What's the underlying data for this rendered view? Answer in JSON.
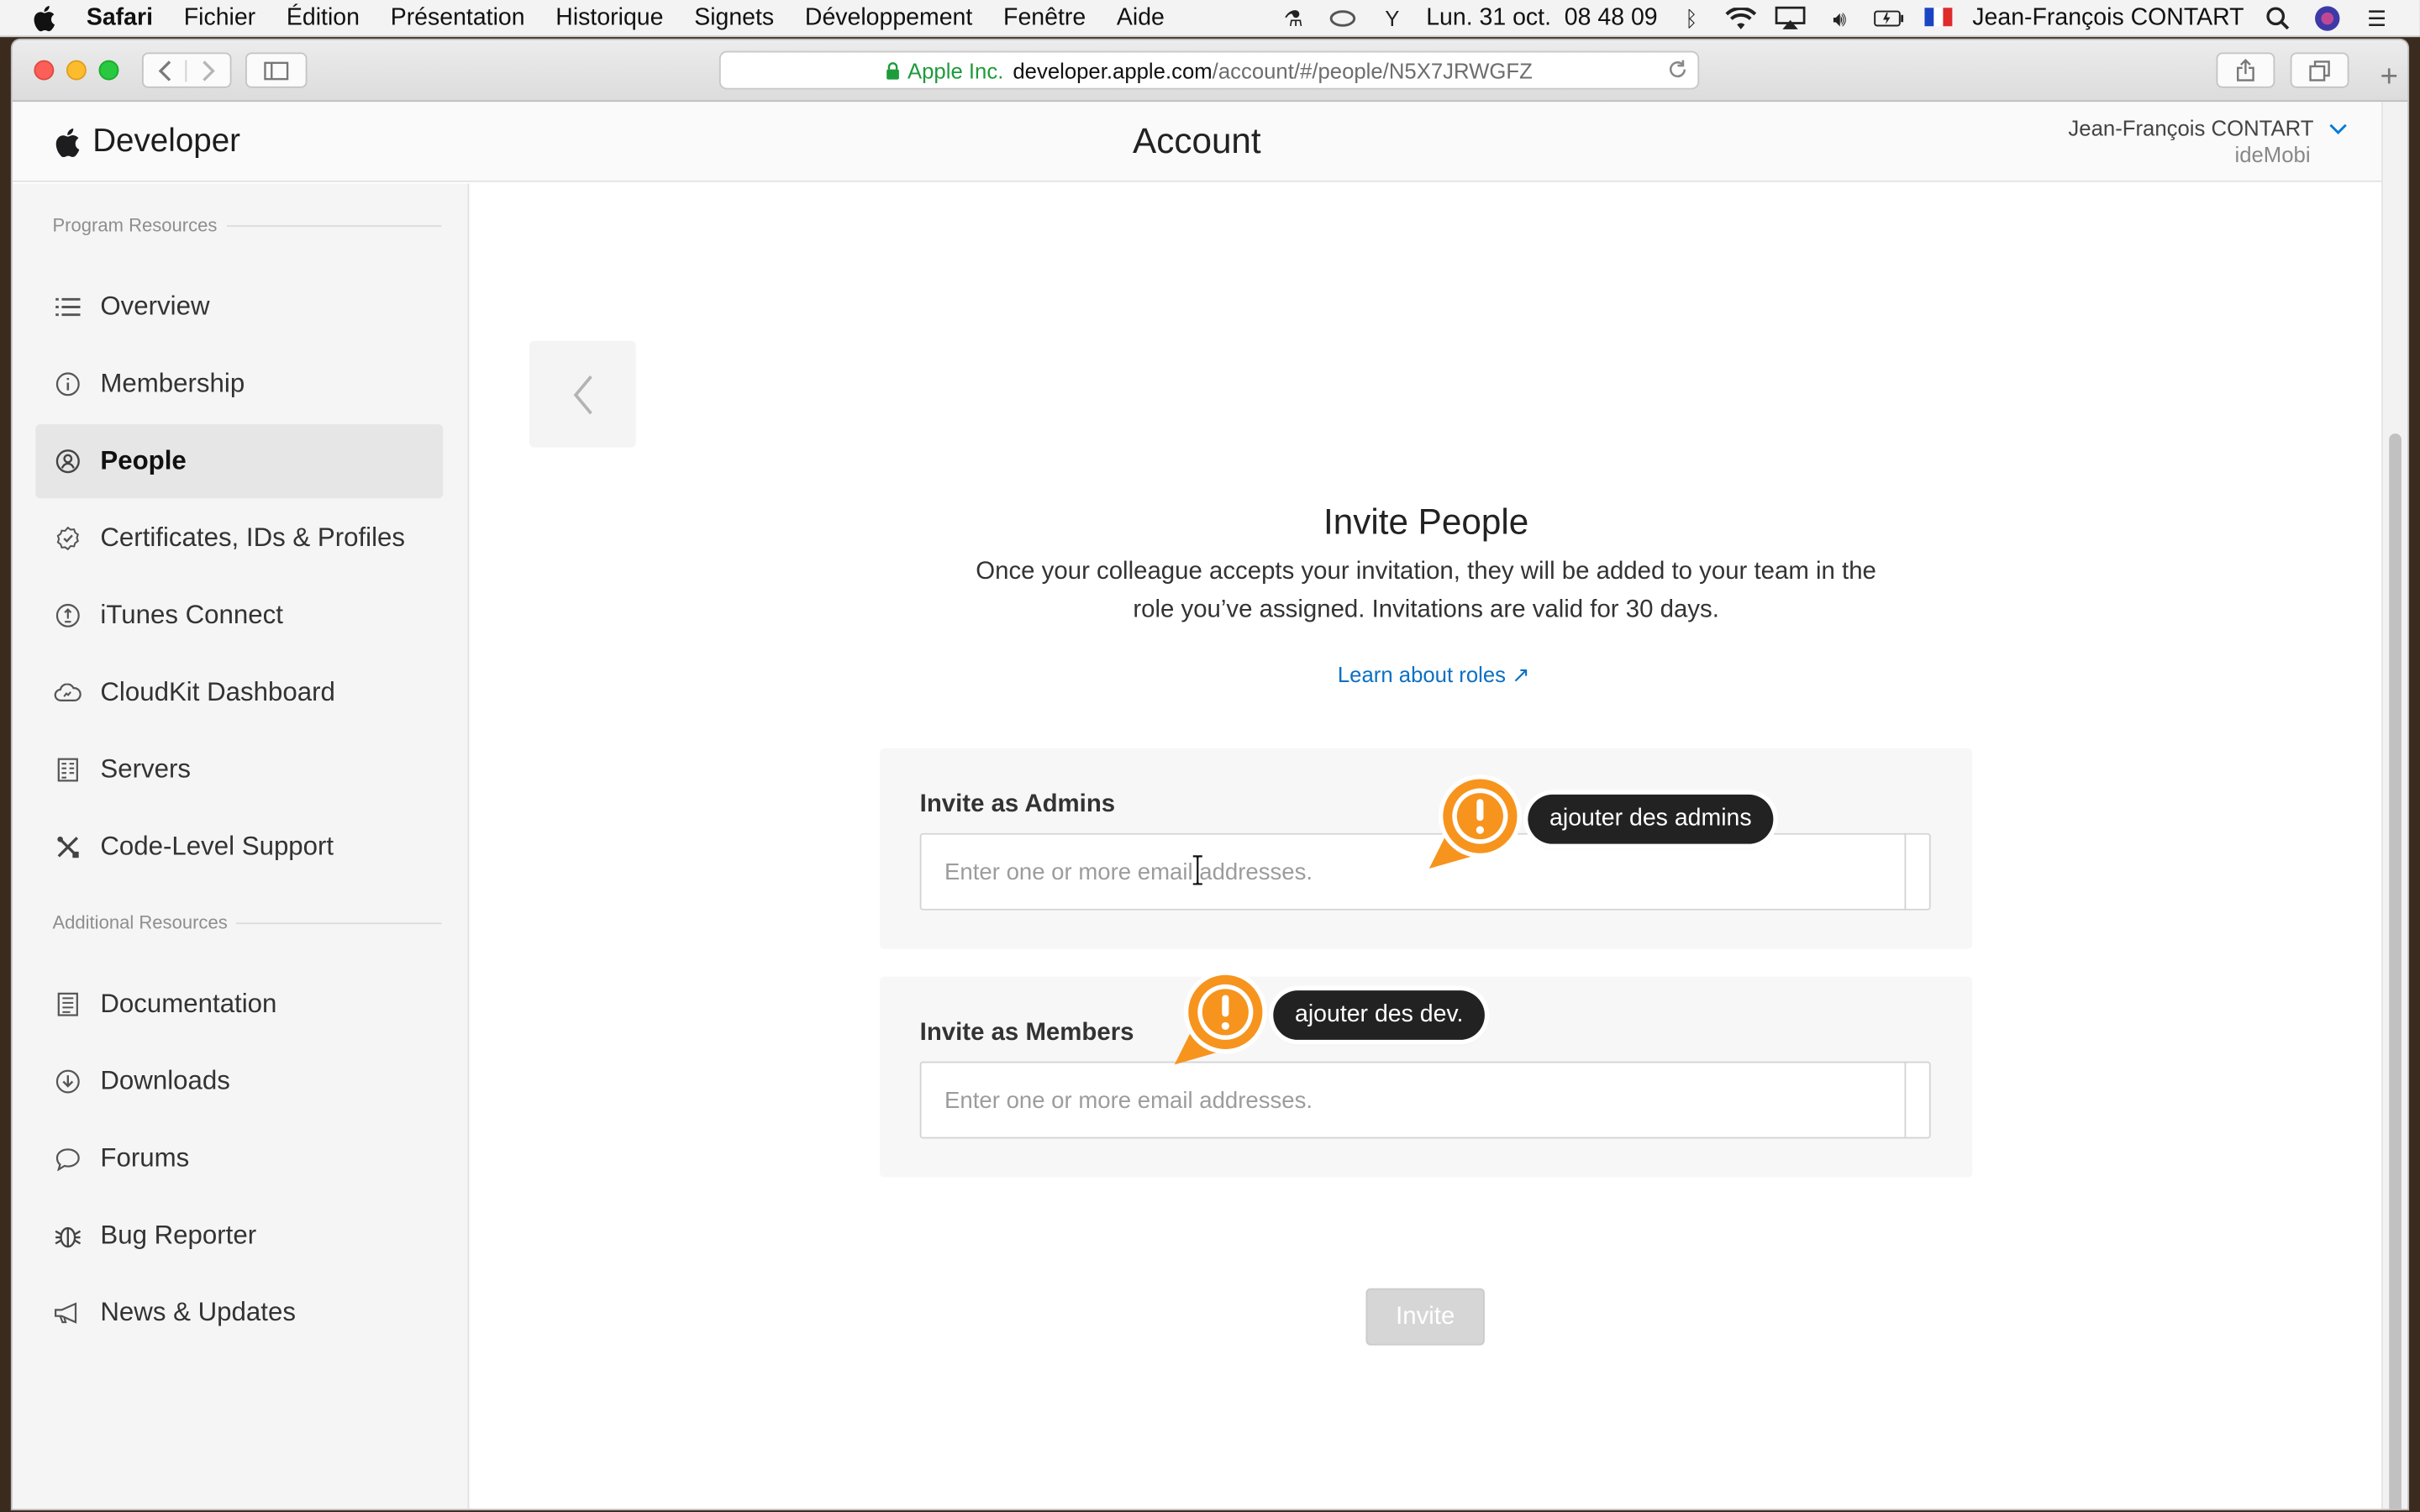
{
  "menubar": {
    "app": "Safari",
    "items": [
      "Fichier",
      "Édition",
      "Présentation",
      "Historique",
      "Signets",
      "Développement",
      "Fenêtre",
      "Aide"
    ],
    "clock": "Lun. 31 oct.  08 48 09",
    "user": "Jean-François CONTART"
  },
  "browser": {
    "site_owner": "Apple Inc.",
    "url_host": "developer.apple.com",
    "url_path": "/account/#/people/N5X7JRWGFZ"
  },
  "header": {
    "brand": "Developer",
    "title": "Account",
    "user_name": "Jean-François CONTART",
    "team": "ideMobi"
  },
  "sidebar": {
    "section1": "Program Resources",
    "items1": [
      {
        "label": "Overview",
        "icon": "list-icon"
      },
      {
        "label": "Membership",
        "icon": "info-icon"
      },
      {
        "label": "People",
        "icon": "person-icon"
      },
      {
        "label": "Certificates, IDs & Profiles",
        "icon": "badge-icon"
      },
      {
        "label": "iTunes Connect",
        "icon": "itunes-icon"
      },
      {
        "label": "CloudKit Dashboard",
        "icon": "cloud-icon"
      },
      {
        "label": "Servers",
        "icon": "server-icon"
      },
      {
        "label": "Code-Level Support",
        "icon": "tools-icon"
      }
    ],
    "section2": "Additional Resources",
    "items2": [
      {
        "label": "Documentation",
        "icon": "document-icon"
      },
      {
        "label": "Downloads",
        "icon": "download-icon"
      },
      {
        "label": "Forums",
        "icon": "chat-icon"
      },
      {
        "label": "Bug Reporter",
        "icon": "bug-icon"
      },
      {
        "label": "News & Updates",
        "icon": "megaphone-icon"
      }
    ]
  },
  "main": {
    "title": "Invite People",
    "description": "Once your colleague accepts your invitation, they will be added to your team in the role you’ve assigned. Invitations are valid for 30 days.",
    "learn_link": "Learn about roles ↗",
    "admins_label": "Invite as Admins",
    "admins_placeholder": "Enter one or more email addresses.",
    "members_label": "Invite as Members",
    "members_placeholder": "Enter one or more email addresses.",
    "invite_button": "Invite"
  },
  "annotations": {
    "admins_note": "ajouter des admins",
    "dev_note": "ajouter des dev."
  },
  "colors": {
    "accent_orange": "#f7941d",
    "link_blue": "#0b70c3",
    "active_item_bg": "#e6e6e6"
  }
}
